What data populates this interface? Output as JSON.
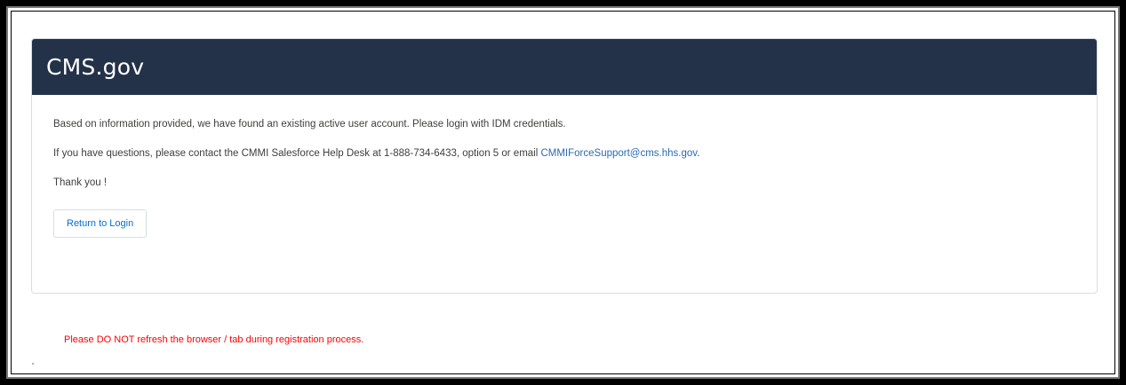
{
  "header": {
    "brand": "CMS.gov"
  },
  "message": {
    "line1": "Based on information provided, we have found an existing active user account. Please login with IDM credentials.",
    "line2_prefix": "If you have questions, please contact the CMMI Salesforce Help Desk at 1-888-734-6433, option 5 or email ",
    "email": "CMMIForceSupport@cms.hhs.gov",
    "line2_suffix": ".",
    "line3": "Thank you !"
  },
  "actions": {
    "return_label": "Return to Login"
  },
  "footer": {
    "warning": "Please DO NOT refresh the browser / tab during registration process."
  },
  "colors": {
    "header_bg": "#243249",
    "link": "#2a6bb3",
    "warning": "#ff0000"
  }
}
